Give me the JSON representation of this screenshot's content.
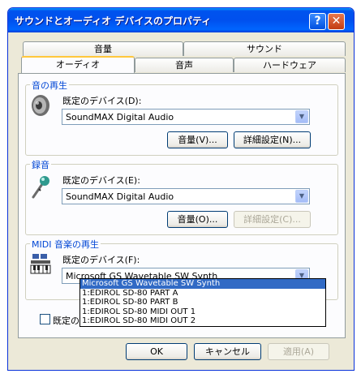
{
  "window": {
    "title": "サウンドとオーディオ デバイスのプロパティ",
    "help_glyph": "?",
    "close_glyph": "✕"
  },
  "tabs": {
    "row_top": [
      "音量",
      "サウンド"
    ],
    "row_bottom": [
      "オーディオ",
      "音声",
      "ハードウェア"
    ],
    "active": "オーディオ"
  },
  "playback": {
    "group_title": "音の再生",
    "device_label": "既定のデバイス(D):",
    "device_value": "SoundMAX Digital Audio",
    "volume_button": "音量(V)...",
    "advanced_button": "詳細設定(N)..."
  },
  "recording": {
    "group_title": "録音",
    "device_label": "既定のデバイス(E):",
    "device_value": "SoundMAX Digital Audio",
    "volume_button": "音量(O)...",
    "advanced_button": "詳細設定(C)..."
  },
  "midi": {
    "group_title": "MIDI 音楽の再生",
    "device_label": "既定のデバイス(F):",
    "device_value": "Microsoft GS Wavetable SW Synth",
    "options": [
      "Microsoft GS Wavetable SW Synth",
      "1:EDIROL SD-80 PART A",
      "1:EDIROL SD-80 PART B",
      "1:EDIROL SD-80 MIDI OUT 1",
      "1:EDIROL SD-80 MIDI OUT 2"
    ],
    "selected_index": 0
  },
  "default_only_checkbox": "既定のデ",
  "footer": {
    "ok": "OK",
    "cancel": "キャンセル",
    "apply": "適用(A)"
  },
  "colors": {
    "titlebar": "#0053ee",
    "group_title": "#0046d5",
    "selection": "#316ac5",
    "active_tab_accent": "#ffc73c"
  }
}
